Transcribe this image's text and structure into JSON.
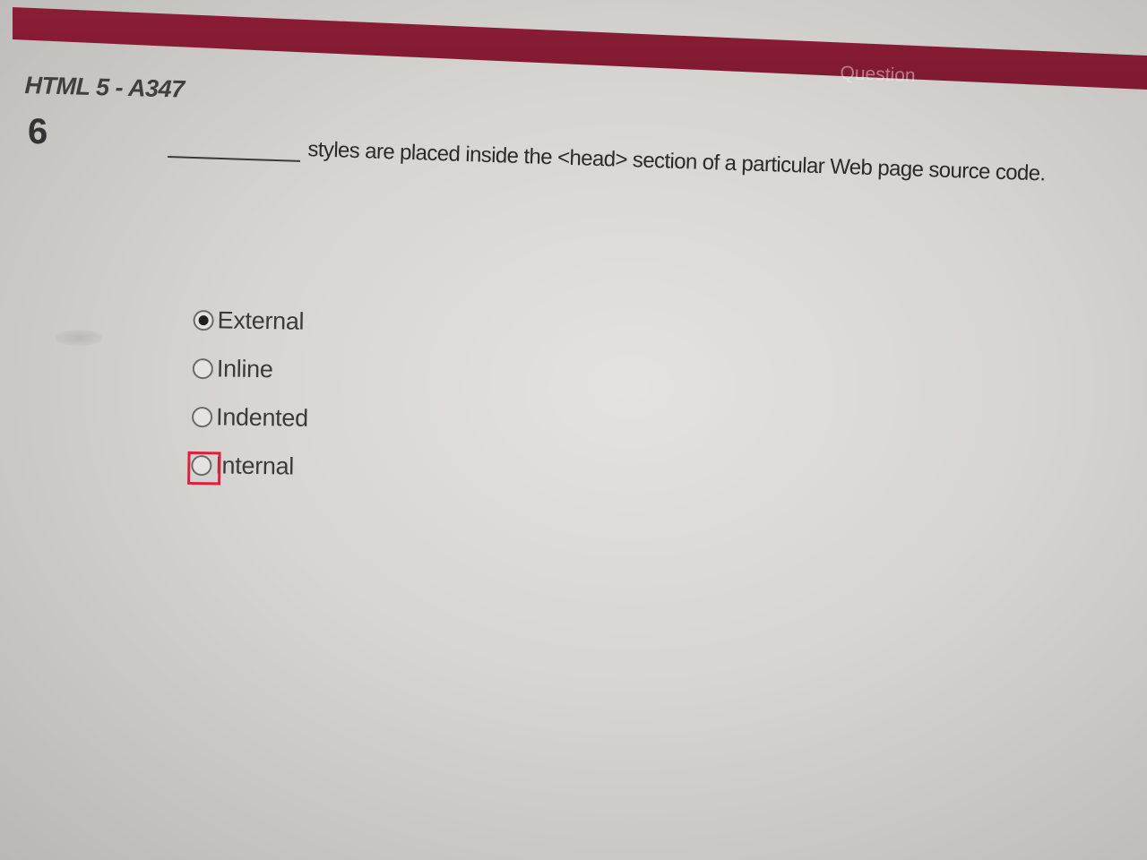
{
  "header": {
    "label": "Question"
  },
  "exam": {
    "title": "HTML 5 - A347"
  },
  "question": {
    "number": "6",
    "text": "styles are placed inside the <head> section of a particular Web page source code."
  },
  "options": [
    {
      "label": "External",
      "selected": true
    },
    {
      "label": "Inline",
      "selected": false
    },
    {
      "label": "Indented",
      "selected": false
    },
    {
      "label": "Internal",
      "selected": false
    }
  ],
  "colors": {
    "header_bar": "#8c1d36",
    "highlight": "#e0203a"
  }
}
